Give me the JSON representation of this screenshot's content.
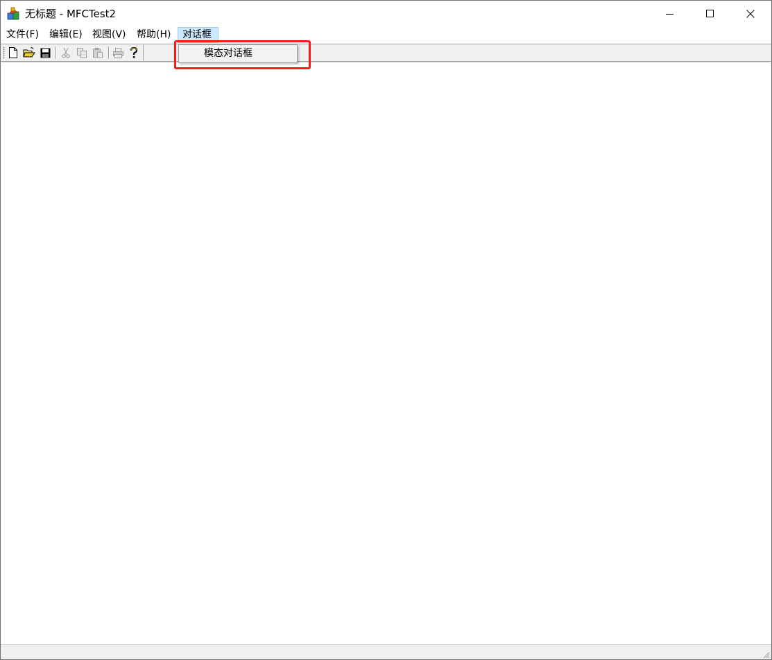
{
  "window": {
    "title": "无标题 - MFCTest2",
    "app_icon": "mfc-app-icon",
    "controls": [
      "minimize-icon",
      "maximize-icon",
      "close-icon"
    ]
  },
  "menubar": {
    "items": [
      {
        "label": "文件(F)"
      },
      {
        "label": "编辑(E)"
      },
      {
        "label": "视图(V)"
      },
      {
        "label": "帮助(H)"
      },
      {
        "label": "对话框",
        "active": true
      }
    ]
  },
  "toolbar": {
    "buttons": [
      {
        "icon": "new-file-icon",
        "enabled": true
      },
      {
        "icon": "open-folder-icon",
        "enabled": true
      },
      {
        "icon": "save-icon",
        "enabled": true
      },
      {
        "icon": "cut-icon",
        "enabled": false
      },
      {
        "icon": "copy-icon",
        "enabled": false
      },
      {
        "icon": "paste-icon",
        "enabled": false
      },
      {
        "icon": "print-icon",
        "enabled": false
      },
      {
        "icon": "help-icon",
        "enabled": true
      }
    ]
  },
  "dropdown": {
    "items": [
      {
        "label": "模态对话框"
      }
    ]
  },
  "colors": {
    "menu_active_bg": "#cce8ff",
    "menu_active_border": "#99d1ff",
    "highlight_box": "#ff1a1a",
    "toolbar_bg": "#f0f0f0"
  }
}
